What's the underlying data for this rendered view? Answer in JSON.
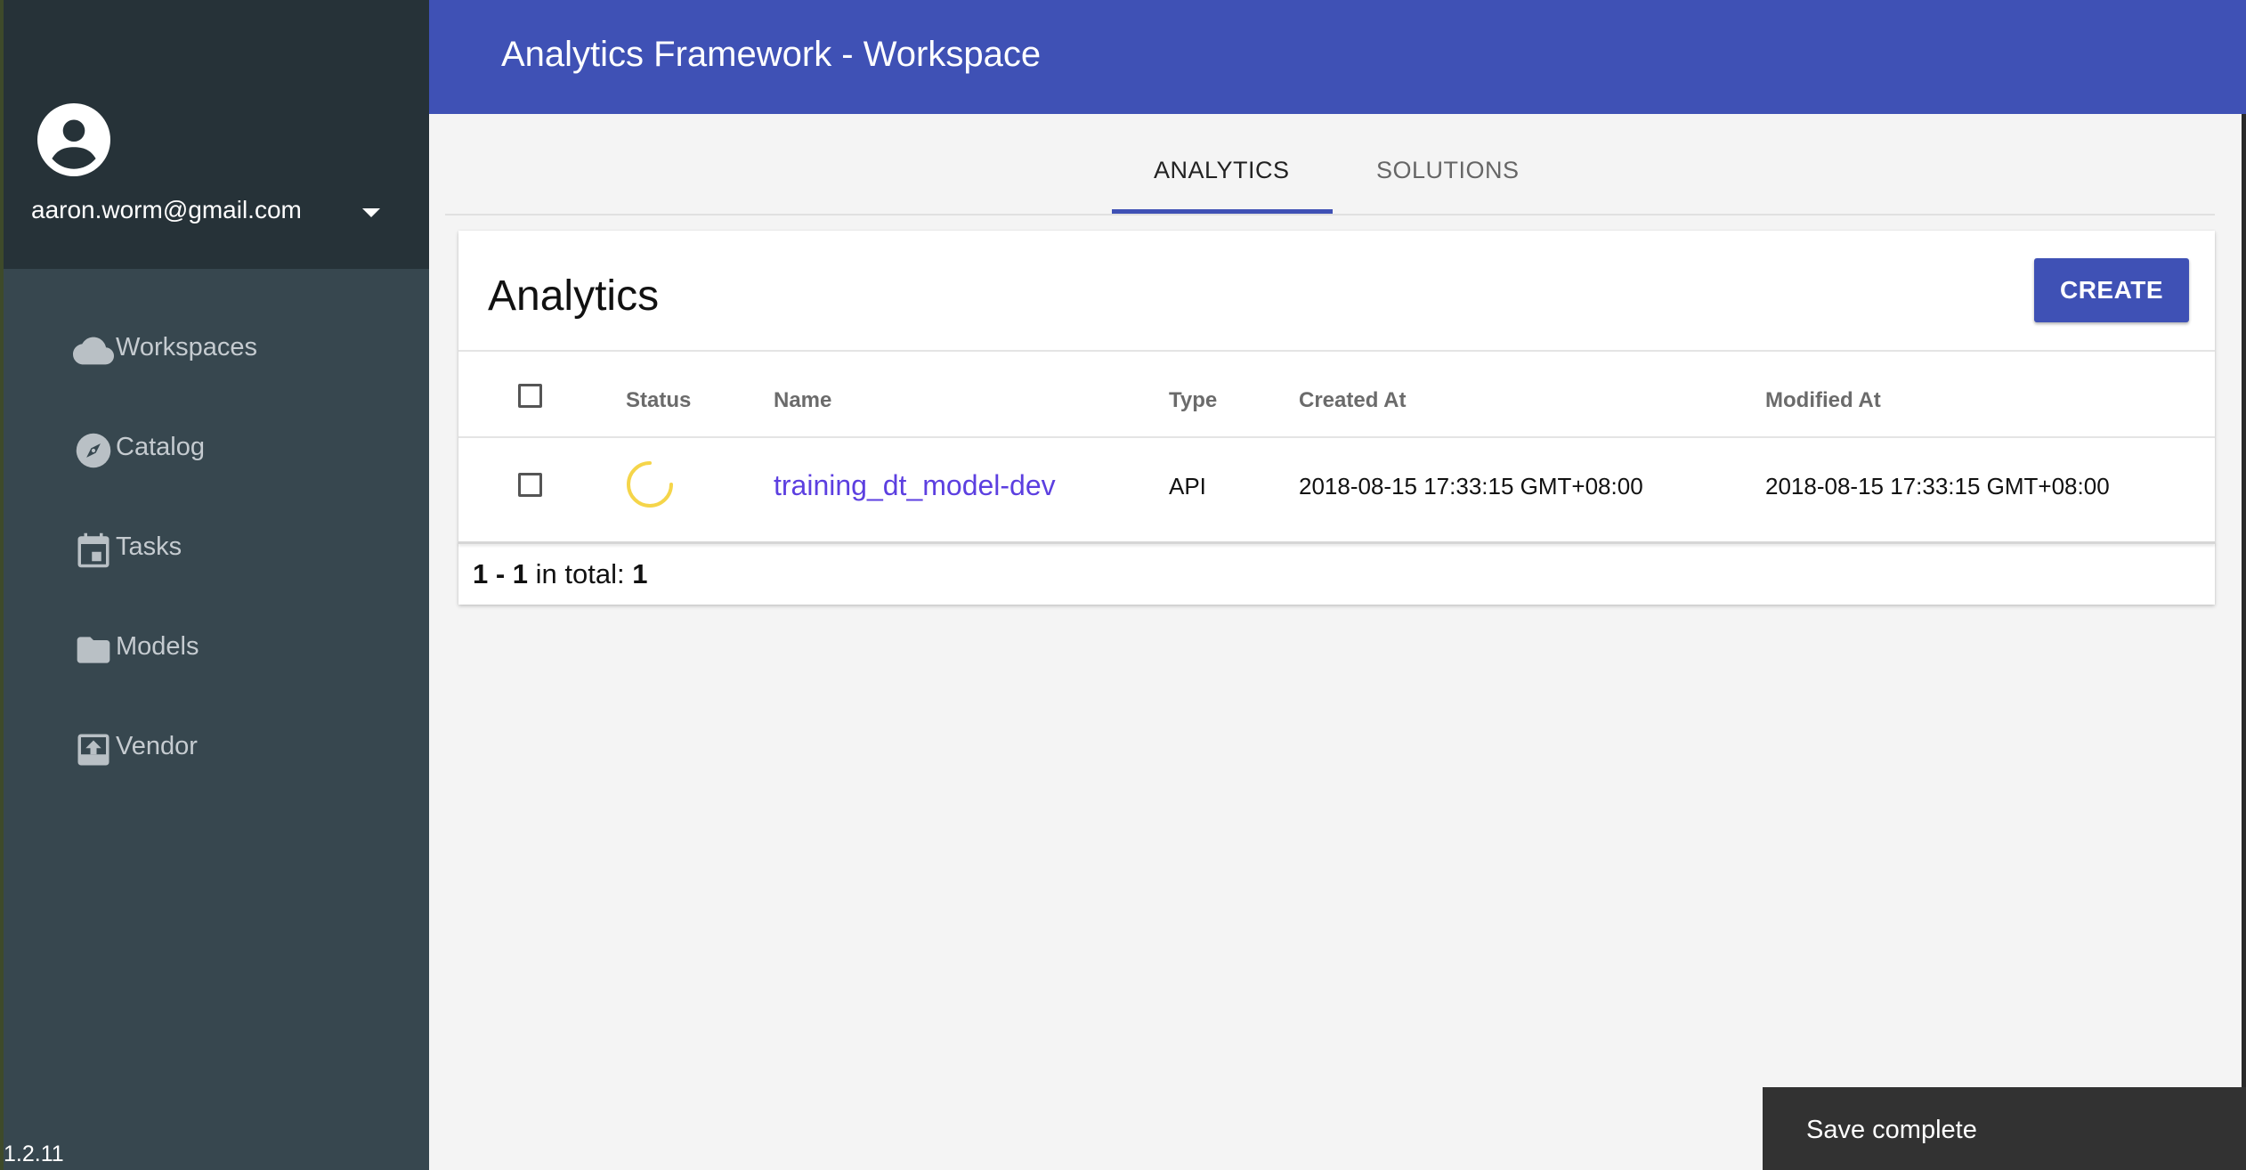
{
  "app": {
    "title": "Analytics Framework - Workspace",
    "version": "1.2.11"
  },
  "account": {
    "email": "aaron.worm@gmail.com"
  },
  "sidebar": {
    "items": [
      {
        "label": "Workspaces",
        "icon": "cloud-icon"
      },
      {
        "label": "Catalog",
        "icon": "compass-icon"
      },
      {
        "label": "Tasks",
        "icon": "calendar-icon"
      },
      {
        "label": "Models",
        "icon": "folder-icon"
      },
      {
        "label": "Vendor",
        "icon": "upload-box-icon"
      }
    ]
  },
  "tabs": [
    {
      "label": "ANALYTICS",
      "active": true
    },
    {
      "label": "SOLUTIONS",
      "active": false
    }
  ],
  "card": {
    "title": "Analytics",
    "create_label": "CREATE"
  },
  "table": {
    "columns": [
      "Status",
      "Name",
      "Type",
      "Created At",
      "Modified At"
    ],
    "rows": [
      {
        "status": "loading",
        "name": "training_dt_model-dev",
        "type": "API",
        "created_at": "2018-08-15 17:33:15 GMT+08:00",
        "modified_at": "2018-08-15 17:33:15 GMT+08:00"
      }
    ]
  },
  "pagination": {
    "range": "1 - 1",
    "label": "in total:",
    "total": "1"
  },
  "toast": {
    "message": "Save complete"
  },
  "colors": {
    "primary": "#3f51b5",
    "sidebar": "#37474f",
    "sidebar_header": "#263238",
    "link": "#5c3fe0",
    "spinner": "#f5d54a"
  }
}
